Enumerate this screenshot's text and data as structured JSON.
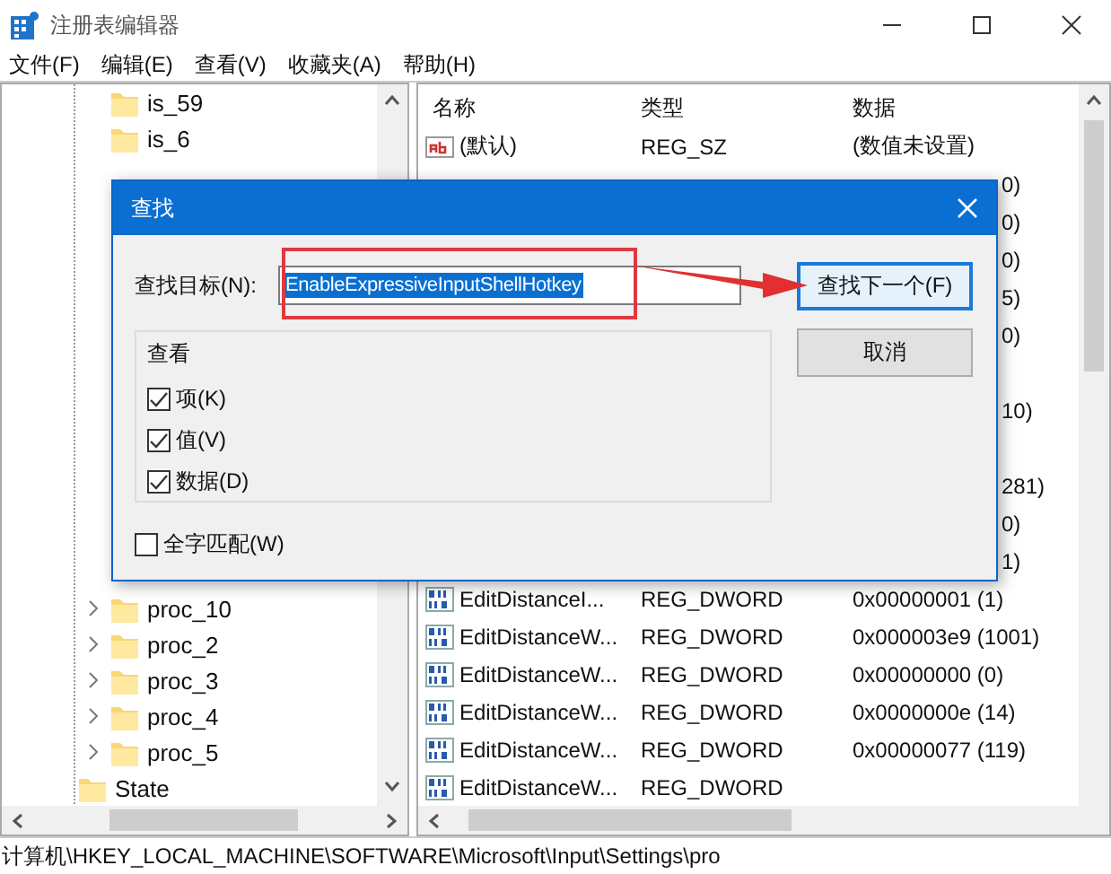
{
  "window": {
    "title": "注册表编辑器"
  },
  "menu": [
    "文件(F)",
    "编辑(E)",
    "查看(V)",
    "收藏夹(A)",
    "帮助(H)"
  ],
  "tree_top": [
    {
      "label": "is_59"
    },
    {
      "label": "is_6"
    }
  ],
  "tree_bottom": [
    {
      "children": [
        {
          "label": "proc_10",
          "expanded": false
        },
        {
          "label": "proc_2",
          "expanded": false
        },
        {
          "label": "proc_3",
          "expanded": false
        },
        {
          "label": "proc_4",
          "expanded": false
        },
        {
          "label": "proc_5",
          "expanded": false
        }
      ]
    },
    {
      "label": "State"
    }
  ],
  "table": {
    "columns": [
      "名称",
      "类型",
      "数据"
    ],
    "rows": [
      {
        "kind": "sz",
        "name": "(默认)",
        "type": "REG_SZ",
        "data": "(数值未设置)"
      },
      {
        "kind": "partial",
        "data": "0)"
      },
      {
        "kind": "partial",
        "data": "0)"
      },
      {
        "kind": "partial",
        "data": "0)"
      },
      {
        "kind": "partial",
        "data": "5)"
      },
      {
        "kind": "partial",
        "data": "0)"
      },
      {
        "kind": "covered"
      },
      {
        "kind": "partial",
        "data": "10)"
      },
      {
        "kind": "covered"
      },
      {
        "kind": "partial",
        "data": "281)"
      },
      {
        "kind": "partial",
        "data": "0)"
      },
      {
        "kind": "partial",
        "data": "1)"
      },
      {
        "kind": "dword",
        "name": "EditDistanceI...",
        "type": "REG_DWORD",
        "data": "0x00000001 (1)"
      },
      {
        "kind": "dword",
        "name": "EditDistanceW...",
        "type": "REG_DWORD",
        "data": "0x000003e9 (1001)"
      },
      {
        "kind": "dword",
        "name": "EditDistanceW...",
        "type": "REG_DWORD",
        "data": "0x00000000 (0)"
      },
      {
        "kind": "dword",
        "name": "EditDistanceW...",
        "type": "REG_DWORD",
        "data": "0x0000000e (14)"
      },
      {
        "kind": "dword",
        "name": "EditDistanceW...",
        "type": "REG_DWORD",
        "data": "0x00000077 (119)"
      },
      {
        "kind": "dword",
        "name": "EditDistanceW...",
        "type": "REG_DWORD"
      }
    ]
  },
  "status_bar": "计算机\\HKEY_LOCAL_MACHINE\\SOFTWARE\\Microsoft\\Input\\Settings\\pro",
  "dialog": {
    "title": "查找",
    "label": "查找目标(N):",
    "value": "EnableExpressiveInputShellHotkey",
    "buttons": [
      {
        "label": "查找下一个(F)",
        "focused": true
      },
      {
        "label": "取消",
        "focused": false
      }
    ],
    "group": "查看",
    "options": [
      {
        "label": "项(K)",
        "checked": true
      },
      {
        "label": "值(V)",
        "checked": true
      },
      {
        "label": "数据(D)",
        "checked": true
      }
    ],
    "whole_word": {
      "label": "全字匹配(W)",
      "checked": false
    }
  }
}
